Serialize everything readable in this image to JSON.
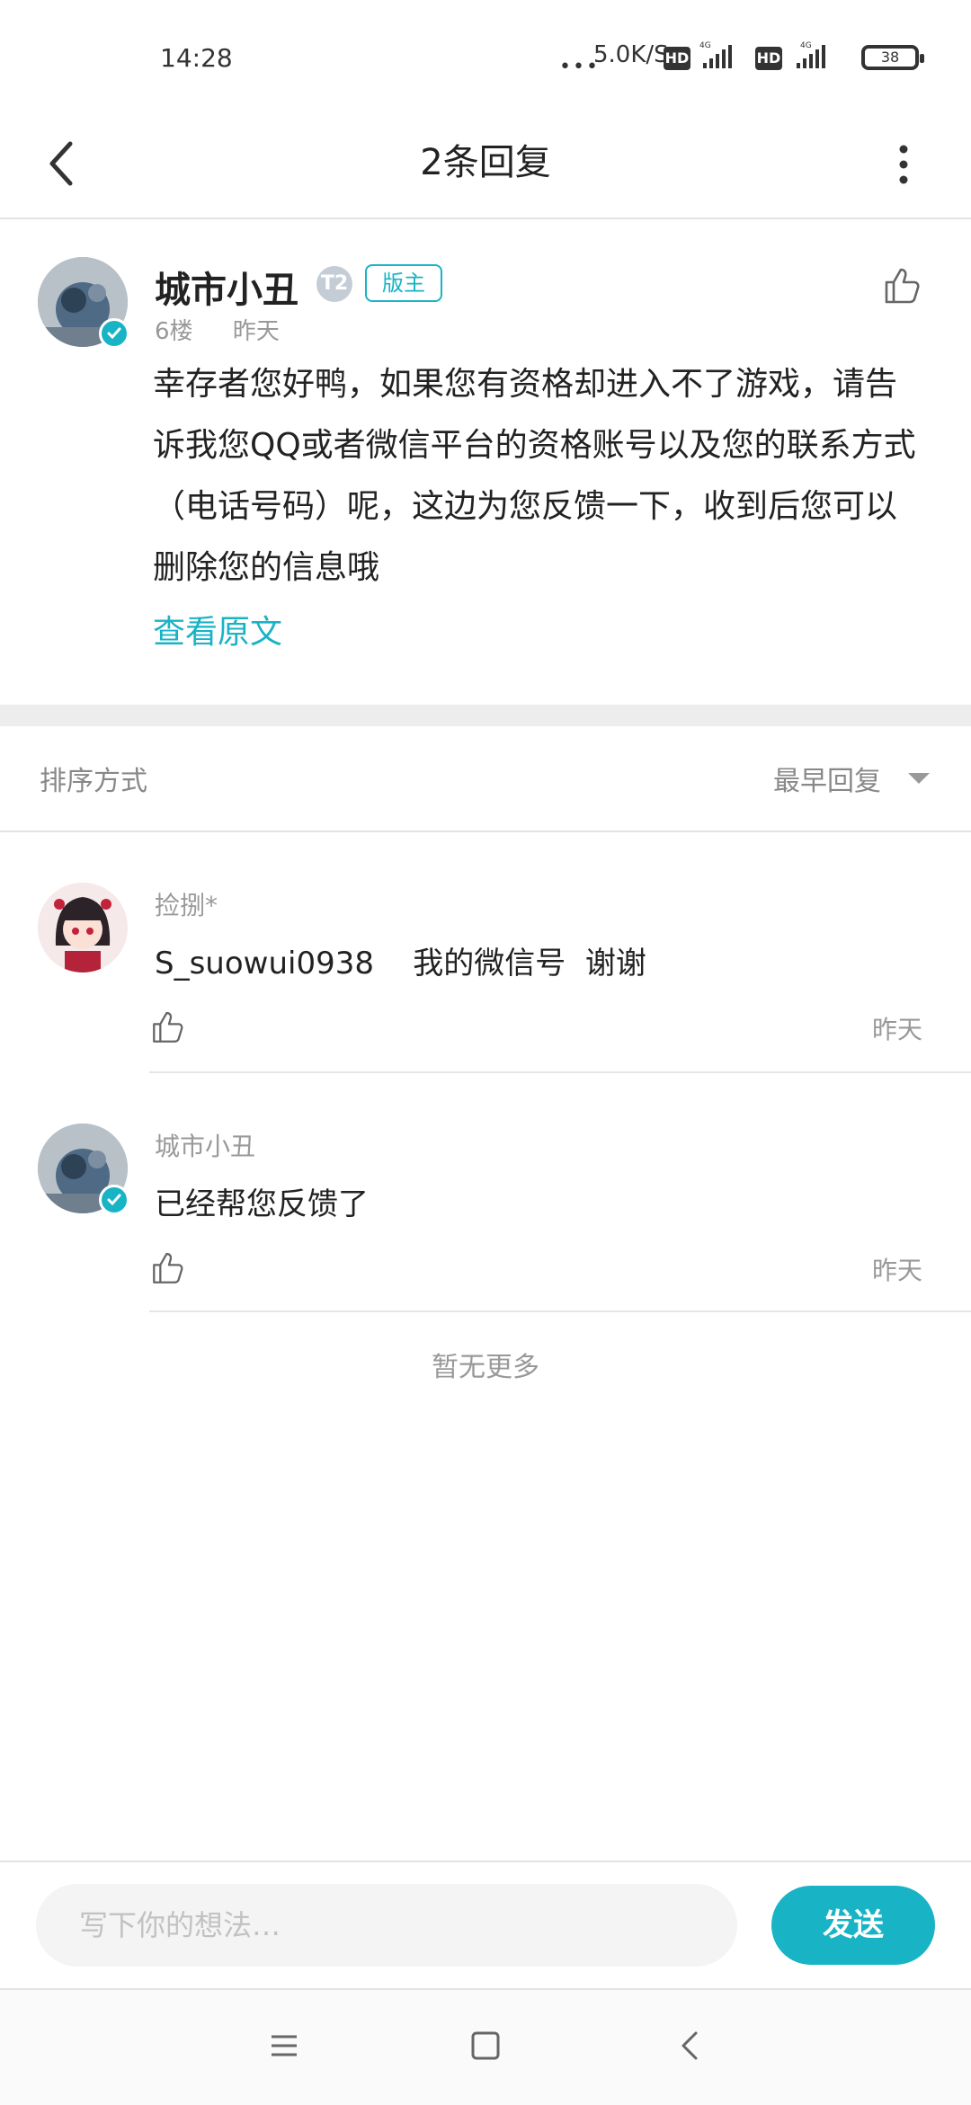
{
  "status_bar": {
    "time": "14:28",
    "net_speed": "5.0K/S",
    "hd1": "HD",
    "hd2": "HD",
    "net_type": "4G",
    "battery": "38"
  },
  "header": {
    "title": "2条回复"
  },
  "post": {
    "author": "城市小丑",
    "level": "T2",
    "mod_badge": "版主",
    "floor": "6楼",
    "time": "昨天",
    "body": "幸存者您好鸭，如果您有资格却进入不了游戏，请告诉我您QQ或者微信平台的资格账号以及您的联系方式（电话号码）呢，这边为您反馈一下，收到后您可以删除您的信息哦",
    "view_original": "查看原文"
  },
  "sort": {
    "label": "排序方式",
    "value": "最早回复"
  },
  "replies": [
    {
      "author": "捡捌*",
      "text": "S_suowui0938    我的微信号  谢谢",
      "time": "昨天"
    },
    {
      "author": "城市小丑",
      "text": "已经帮您反馈了",
      "time": "昨天"
    }
  ],
  "no_more": "暂无更多",
  "input": {
    "placeholder": "写下你的想法…",
    "send_label": "发送"
  },
  "colors": {
    "accent": "#19b3c6"
  },
  "icons": [
    "back-icon",
    "more-icon",
    "thumbs-up-icon",
    "verified-icon",
    "menu-icon",
    "home-icon",
    "back-nav-icon"
  ]
}
